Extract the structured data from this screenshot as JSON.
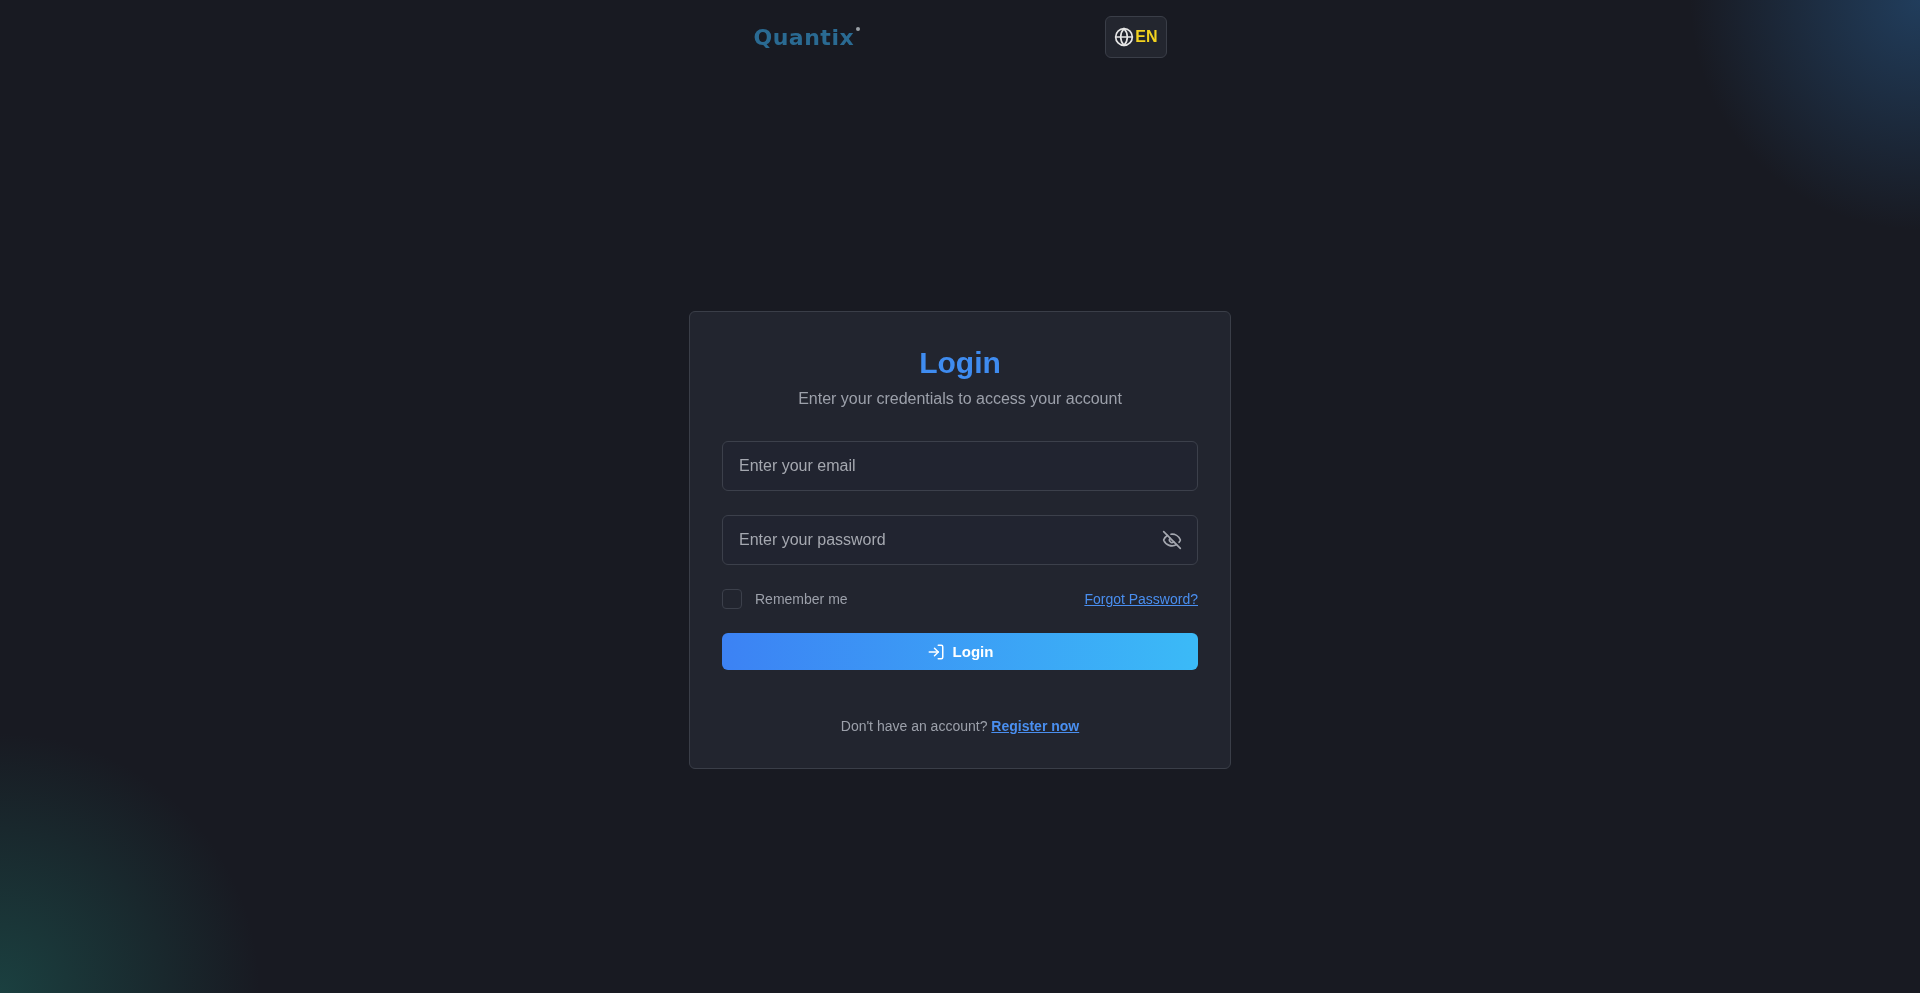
{
  "header": {
    "logo": "Quantix",
    "language": "EN"
  },
  "login": {
    "title": "Login",
    "subtitle": "Enter your credentials to access your account",
    "email": {
      "placeholder": "Enter your email"
    },
    "password": {
      "placeholder": "Enter your password"
    },
    "remember": {
      "label": "Remember me",
      "checked": false
    },
    "forgot": "Forgot Password?",
    "submit": "Login",
    "register_prompt": "Don't have an account?",
    "register_link": "Register now"
  }
}
